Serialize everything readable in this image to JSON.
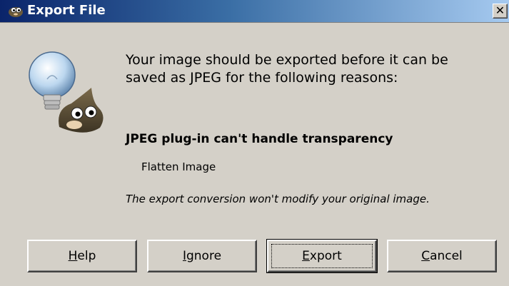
{
  "window": {
    "title": "Export File",
    "close_glyph": "✕"
  },
  "icons": {
    "title": "gimp-wilber-icon",
    "dialog": "lightbulb-wilber-icon"
  },
  "message": {
    "text": "Your image should be exported before it can be saved as JPEG for the following reasons:",
    "reason_title": "JPEG plug-in can't handle transparency",
    "reason_item": "Flatten Image",
    "note": "The export conversion won't modify your original image."
  },
  "buttons": [
    {
      "label": "Help",
      "mnemonic": "H",
      "rest": "elp"
    },
    {
      "label": "Ignore",
      "mnemonic": "I",
      "rest": "gnore"
    },
    {
      "label": "Export",
      "mnemonic": "E",
      "rest": "xport",
      "default": true
    },
    {
      "label": "Cancel",
      "mnemonic": "C",
      "rest": "ancel"
    }
  ],
  "colors": {
    "titlebar_start": "#0a246a",
    "titlebar_end": "#a6caf0",
    "dialog_bg": "#d4d0c8"
  }
}
